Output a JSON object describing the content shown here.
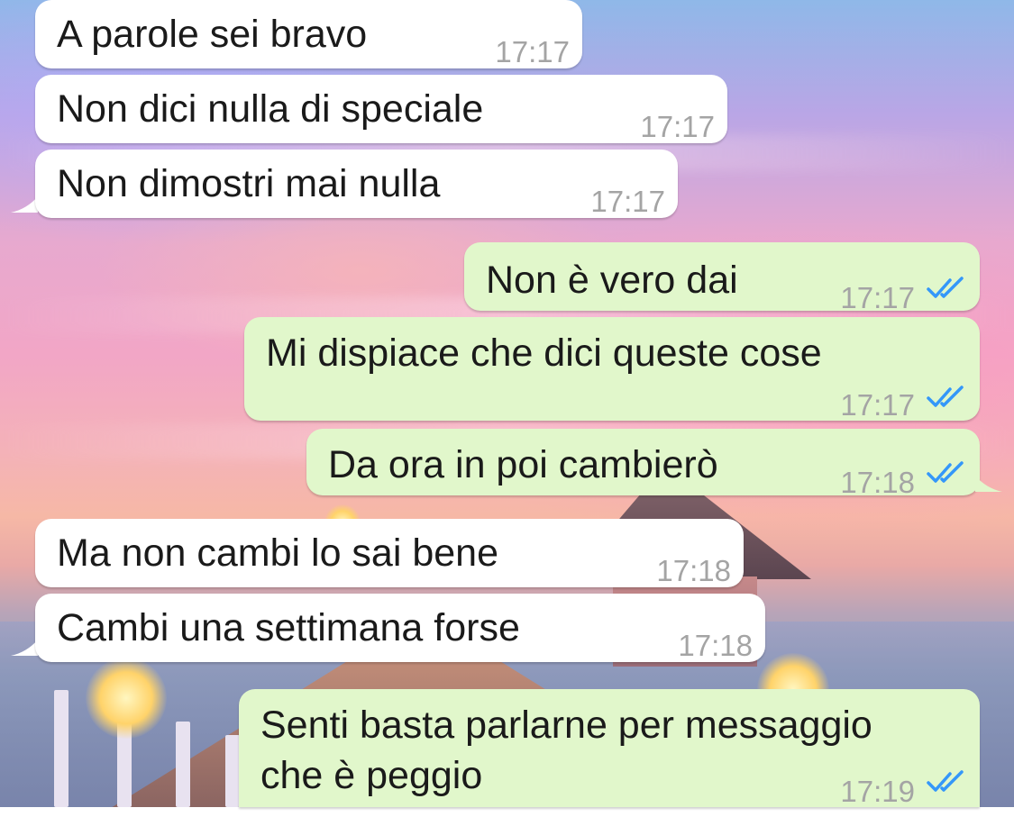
{
  "chat": {
    "messages": [
      {
        "text": "A parole sei bravo",
        "time": "17:17"
      },
      {
        "text": "Non dici nulla di speciale",
        "time": "17:17"
      },
      {
        "text": "Non dimostri mai nulla",
        "time": "17:17"
      },
      {
        "text": "Non è vero dai",
        "time": "17:17",
        "status": "read"
      },
      {
        "text": "Mi dispiace che dici queste cose",
        "time": "17:17",
        "status": "read"
      },
      {
        "text": "Da ora in poi cambierò",
        "time": "17:18",
        "status": "read"
      },
      {
        "text": "Ma non cambi lo sai bene",
        "time": "17:18"
      },
      {
        "text": "Cambi una settimana forse",
        "time": "17:18"
      },
      {
        "text_line1": "Senti basta parlarne per messaggio",
        "text_line2": "che è peggio",
        "time": "17:19",
        "status": "read"
      }
    ]
  },
  "colors": {
    "incoming_bubble": "#ffffff",
    "outgoing_bubble": "#e1f7cb",
    "read_ticks": "#3497f9",
    "timestamp": "#a4a4a4"
  },
  "icons": {
    "read_receipt": "double-check-icon"
  }
}
